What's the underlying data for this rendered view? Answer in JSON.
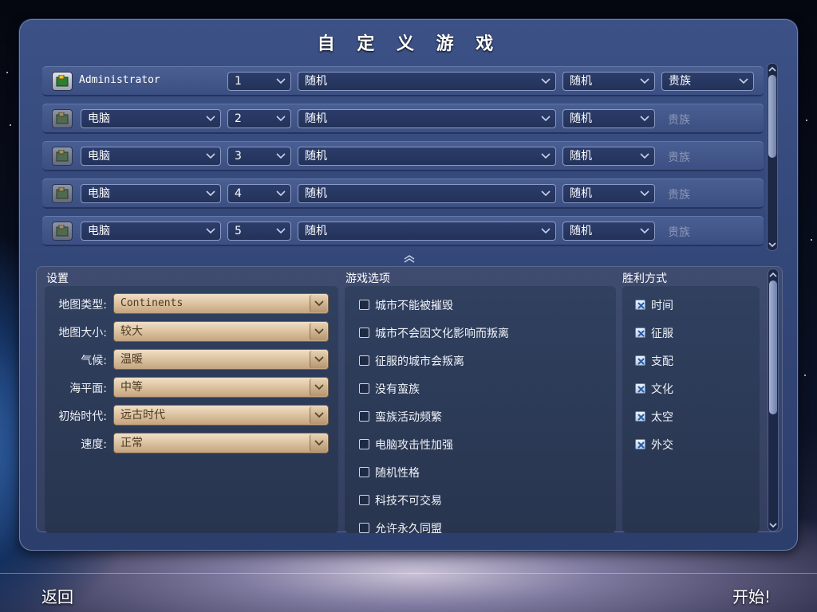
{
  "title": "自 定 义 游 戏",
  "players": [
    {
      "name": "Administrator",
      "team": "1",
      "civ": "随机",
      "leader": "随机",
      "difficulty": "贵族",
      "is_human": true
    },
    {
      "name": "电脑",
      "team": "2",
      "civ": "随机",
      "leader": "随机",
      "difficulty": "贵族",
      "is_human": false
    },
    {
      "name": "电脑",
      "team": "3",
      "civ": "随机",
      "leader": "随机",
      "difficulty": "贵族",
      "is_human": false
    },
    {
      "name": "电脑",
      "team": "4",
      "civ": "随机",
      "leader": "随机",
      "difficulty": "贵族",
      "is_human": false
    },
    {
      "name": "电脑",
      "team": "5",
      "civ": "随机",
      "leader": "随机",
      "difficulty": "贵族",
      "is_human": false
    }
  ],
  "settings": {
    "title": "设置",
    "rows": [
      {
        "label": "地图类型:",
        "value": "Continents"
      },
      {
        "label": "地图大小:",
        "value": "较大"
      },
      {
        "label": "气候:",
        "value": "温暖"
      },
      {
        "label": "海平面:",
        "value": "中等"
      },
      {
        "label": "初始时代:",
        "value": "远古时代"
      },
      {
        "label": "速度:",
        "value": "正常"
      }
    ]
  },
  "game_options": {
    "title": "游戏选项",
    "items": [
      {
        "label": "城市不能被摧毁",
        "checked": false
      },
      {
        "label": "城市不会因文化影响而叛离",
        "checked": false
      },
      {
        "label": "征服的城市会叛离",
        "checked": false
      },
      {
        "label": "没有蛮族",
        "checked": false
      },
      {
        "label": "蛮族活动频繁",
        "checked": false
      },
      {
        "label": "电脑攻击性加强",
        "checked": false
      },
      {
        "label": "随机性格",
        "checked": false
      },
      {
        "label": "科技不可交易",
        "checked": false
      },
      {
        "label": "允许永久同盟",
        "checked": false
      }
    ]
  },
  "victory": {
    "title": "胜利方式",
    "items": [
      {
        "label": "时间",
        "checked": true
      },
      {
        "label": "征服",
        "checked": true
      },
      {
        "label": "支配",
        "checked": true
      },
      {
        "label": "文化",
        "checked": true
      },
      {
        "label": "太空",
        "checked": true
      },
      {
        "label": "外交",
        "checked": true
      }
    ]
  },
  "footer": {
    "back_label": "返回",
    "start_label": "开始!"
  },
  "colors": {
    "panel": "#3c5186",
    "dropdown_border": "#8b9cc6",
    "settings_dropdown": "#d9bf9c",
    "checkbox_checked": "#b6cde9"
  }
}
